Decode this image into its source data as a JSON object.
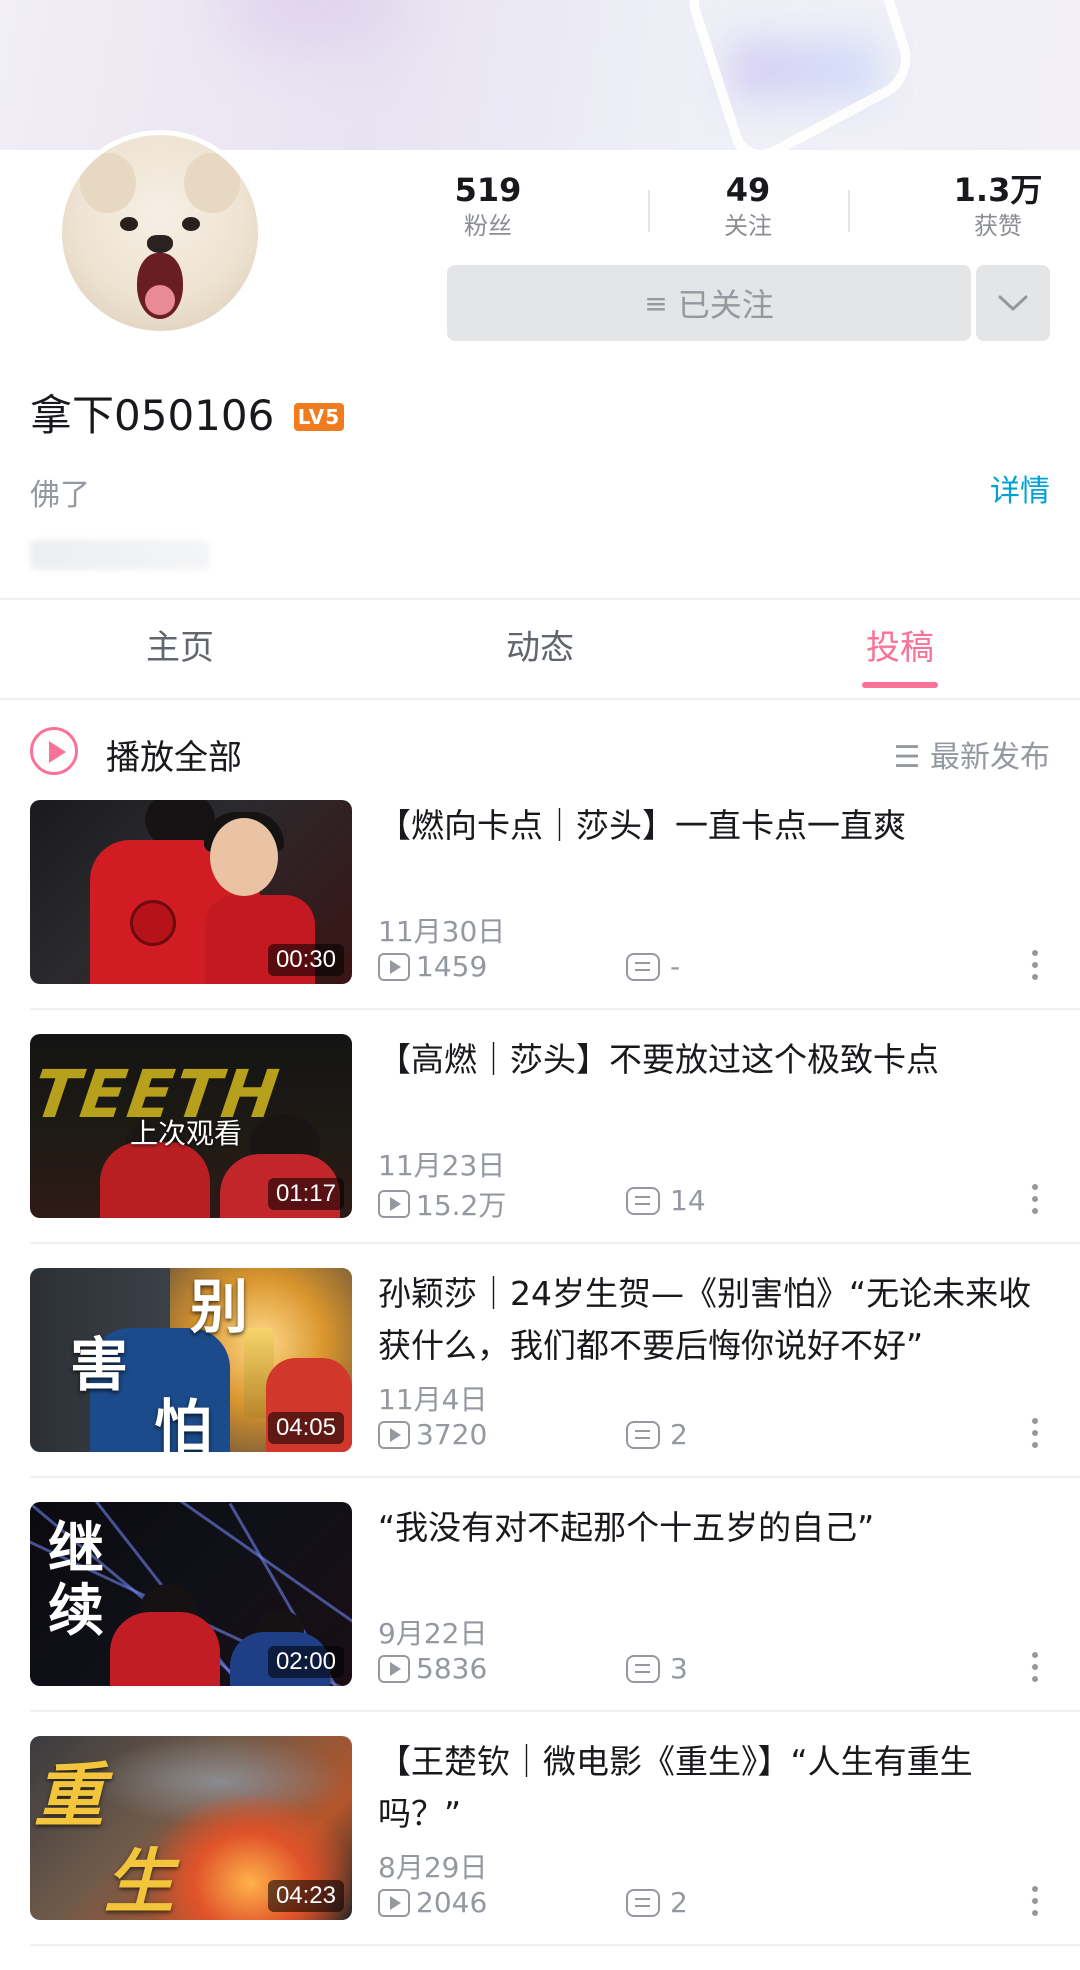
{
  "profile": {
    "stats": [
      {
        "value": "519",
        "label": "粉丝"
      },
      {
        "value": "49",
        "label": "关注"
      },
      {
        "value": "1.3万",
        "label": "获赞"
      }
    ],
    "follow_button": "已关注",
    "name": "拿下050106",
    "level": "LV5",
    "signature": "佛了",
    "detail_link": "详情"
  },
  "tabs": [
    {
      "label": "主页",
      "active": false
    },
    {
      "label": "动态",
      "active": false
    },
    {
      "label": "投稿",
      "active": true
    }
  ],
  "list_header": {
    "play_all": "播放全部",
    "sort": "最新发布"
  },
  "videos": [
    {
      "title": "【燃向卡点｜莎头】一直卡点一直爽",
      "date": "11月30日",
      "views": "1459",
      "comments": "-",
      "duration": "00:30"
    },
    {
      "title": "【高燃｜莎头】不要放过这个极致卡点",
      "date": "11月23日",
      "views": "15.2万",
      "comments": "14",
      "duration": "01:17",
      "overlay": "上次观看",
      "thumb_text": "TEETH"
    },
    {
      "title": "孙颖莎｜24岁生贺—《别害怕》“无论未来收获什么，我们都不要后悔你说好不好”",
      "date": "11月4日",
      "views": "3720",
      "comments": "2",
      "duration": "04:05",
      "thumb_text": [
        "别",
        "害",
        "怕"
      ]
    },
    {
      "title": "“我没有对不起那个十五岁的自己”",
      "date": "9月22日",
      "views": "5836",
      "comments": "3",
      "duration": "02:00",
      "thumb_text": [
        "继",
        "续"
      ]
    },
    {
      "title": "【王楚钦｜微电影《重生》】“人生有重生吗？”",
      "date": "8月29日",
      "views": "2046",
      "comments": "2",
      "duration": "04:23",
      "thumb_text": [
        "重",
        "生"
      ]
    }
  ],
  "colors": {
    "accent_pink": "#fb7299",
    "link_blue": "#00a1d6",
    "level_badge": "#f07c1f",
    "muted_text": "#9499a0"
  }
}
